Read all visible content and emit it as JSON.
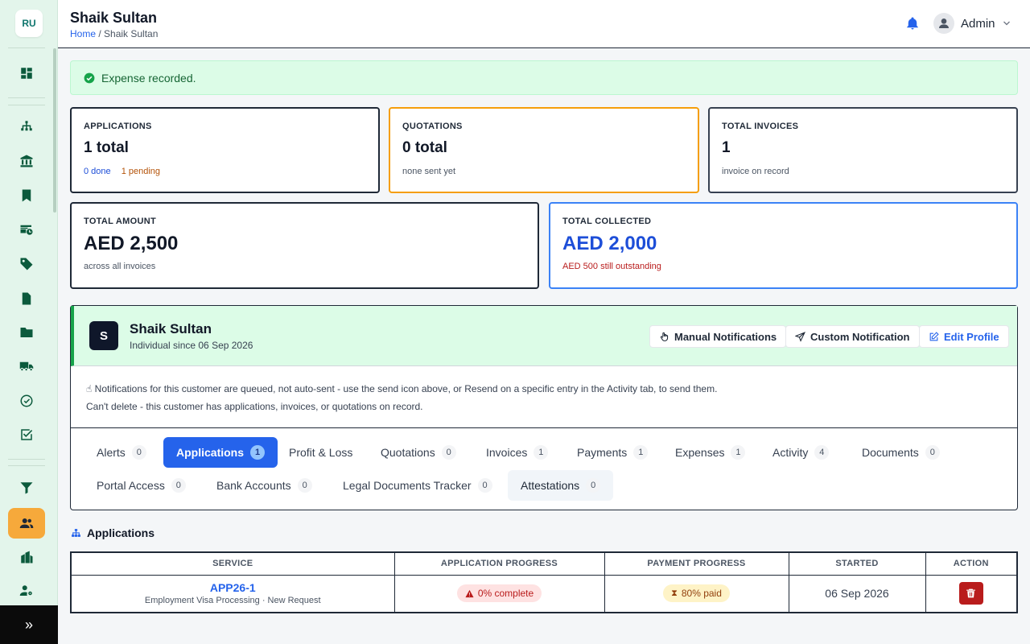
{
  "sidebar": {
    "logo": "RU",
    "footer_icon": "»"
  },
  "header": {
    "title": "Shaik Sultan",
    "breadcrumb_home": "Home",
    "breadcrumb_sep": " / ",
    "breadcrumb_current": "Shaik Sultan",
    "user": "Admin"
  },
  "alert": {
    "text": "Expense recorded."
  },
  "cards": {
    "applications": {
      "label": "APPLICATIONS",
      "value": "1 total",
      "done": "0 done",
      "pending": "1 pending"
    },
    "quotations": {
      "label": "QUOTATIONS",
      "value": "0 total",
      "sub": "none sent yet"
    },
    "invoices": {
      "label": "TOTAL INVOICES",
      "value": "1",
      "sub": "invoice on record"
    },
    "amount": {
      "label": "TOTAL AMOUNT",
      "value": "AED 2,500",
      "sub": "across all invoices"
    },
    "collected": {
      "label": "TOTAL COLLECTED",
      "value": "AED 2,000",
      "sub": "AED 500 still outstanding"
    }
  },
  "profile": {
    "initial": "S",
    "name": "Shaik Sultan",
    "since": "Individual since 06 Sep 2026",
    "btn_manual": "Manual Notifications",
    "btn_custom": "Custom Notification",
    "btn_edit": "Edit Profile",
    "notice": "Notifications for this customer are queued, not auto-sent - use the send icon above, or Resend on a specific entry in the Activity tab, to send them.",
    "notice2": "Can't delete - this customer has applications, invoices, or quotations on record."
  },
  "tabs": [
    {
      "label": "Alerts",
      "count": "0"
    },
    {
      "label": "Applications",
      "count": "1"
    },
    {
      "label": "Profit & Loss",
      "count": ""
    },
    {
      "label": "Quotations",
      "count": "0"
    },
    {
      "label": "Invoices",
      "count": "1"
    },
    {
      "label": "Payments",
      "count": "1"
    },
    {
      "label": "Expenses",
      "count": "1"
    },
    {
      "label": "Activity",
      "count": "4"
    },
    {
      "label": "Documents",
      "count": "0"
    },
    {
      "label": "Portal Access",
      "count": "0"
    },
    {
      "label": "Bank Accounts",
      "count": "0"
    },
    {
      "label": "Legal Documents Tracker",
      "count": "0"
    },
    {
      "label": "Attestations",
      "count": "0"
    }
  ],
  "applications": {
    "title": "Applications",
    "headers": [
      "SERVICE",
      "APPLICATION PROGRESS",
      "PAYMENT PROGRESS",
      "STARTED",
      "ACTION"
    ],
    "rows": [
      {
        "id": "APP26-1",
        "desc": "Employment Visa Processing · New Request",
        "app_progress": "0% complete",
        "pay_progress": "80% paid",
        "started": "06 Sep 2026"
      }
    ]
  },
  "colors": {
    "accent": "#2563eb",
    "sidebar_bg": "#e3f5eb",
    "active_nav": "#f6a93b",
    "success_bg": "#dcfce7",
    "danger": "#b91c1c"
  }
}
